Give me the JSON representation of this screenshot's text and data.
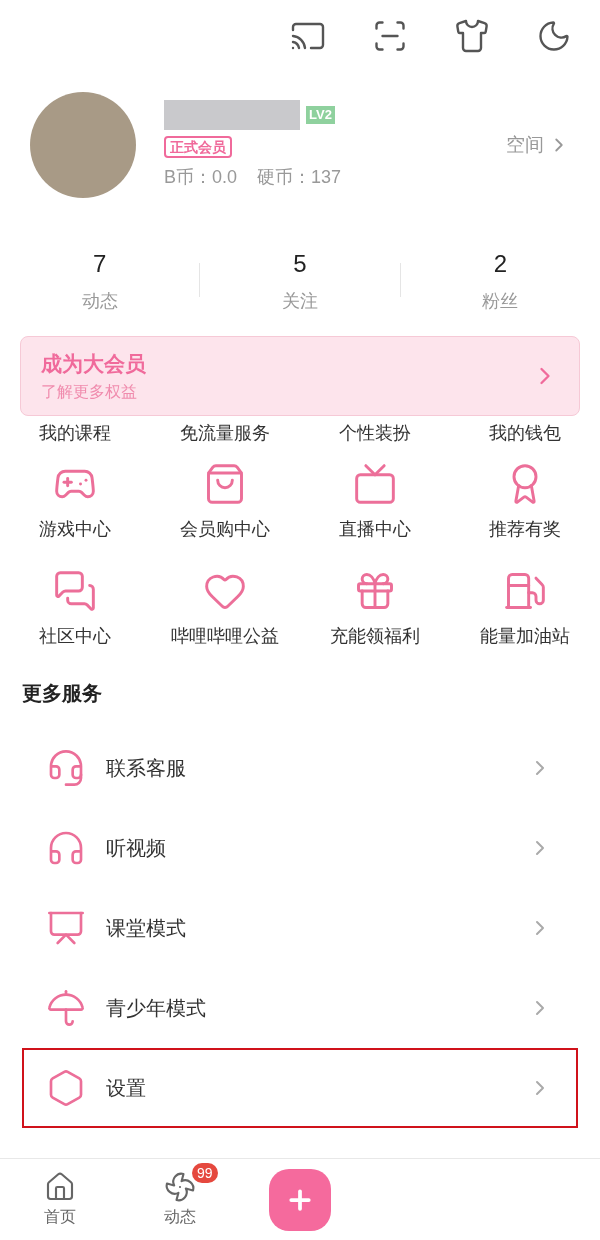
{
  "profile": {
    "level_badge": "LV2",
    "membership": "正式会员",
    "b_coins": "B币：0.0",
    "coins": "硬币：137",
    "space_link": "空间"
  },
  "stats": [
    {
      "value": "7",
      "label": "动态"
    },
    {
      "value": "5",
      "label": "关注"
    },
    {
      "value": "2",
      "label": "粉丝"
    }
  ],
  "vip_banner": {
    "title": "成为大会员",
    "subtitle": "了解更多权益"
  },
  "cut_row": [
    "我的课程",
    "免流量服务",
    "个性装扮",
    "我的钱包"
  ],
  "services": [
    {
      "label": "游戏中心"
    },
    {
      "label": "会员购中心"
    },
    {
      "label": "直播中心"
    },
    {
      "label": "推荐有奖"
    },
    {
      "label": "社区中心"
    },
    {
      "label": "哔哩哔哩公益"
    },
    {
      "label": "充能领福利"
    },
    {
      "label": "能量加油站"
    }
  ],
  "more_services": {
    "title": "更多服务",
    "items": [
      {
        "label": "联系客服",
        "highlighted": false
      },
      {
        "label": "听视频",
        "highlighted": false
      },
      {
        "label": "课堂模式",
        "highlighted": false
      },
      {
        "label": "青少年模式",
        "highlighted": false
      },
      {
        "label": "设置",
        "highlighted": true
      }
    ]
  },
  "bottom_nav": [
    {
      "kind": "tab",
      "label": "首页"
    },
    {
      "kind": "tab",
      "label": "动态",
      "badge": "99"
    },
    {
      "kind": "publish"
    }
  ]
}
